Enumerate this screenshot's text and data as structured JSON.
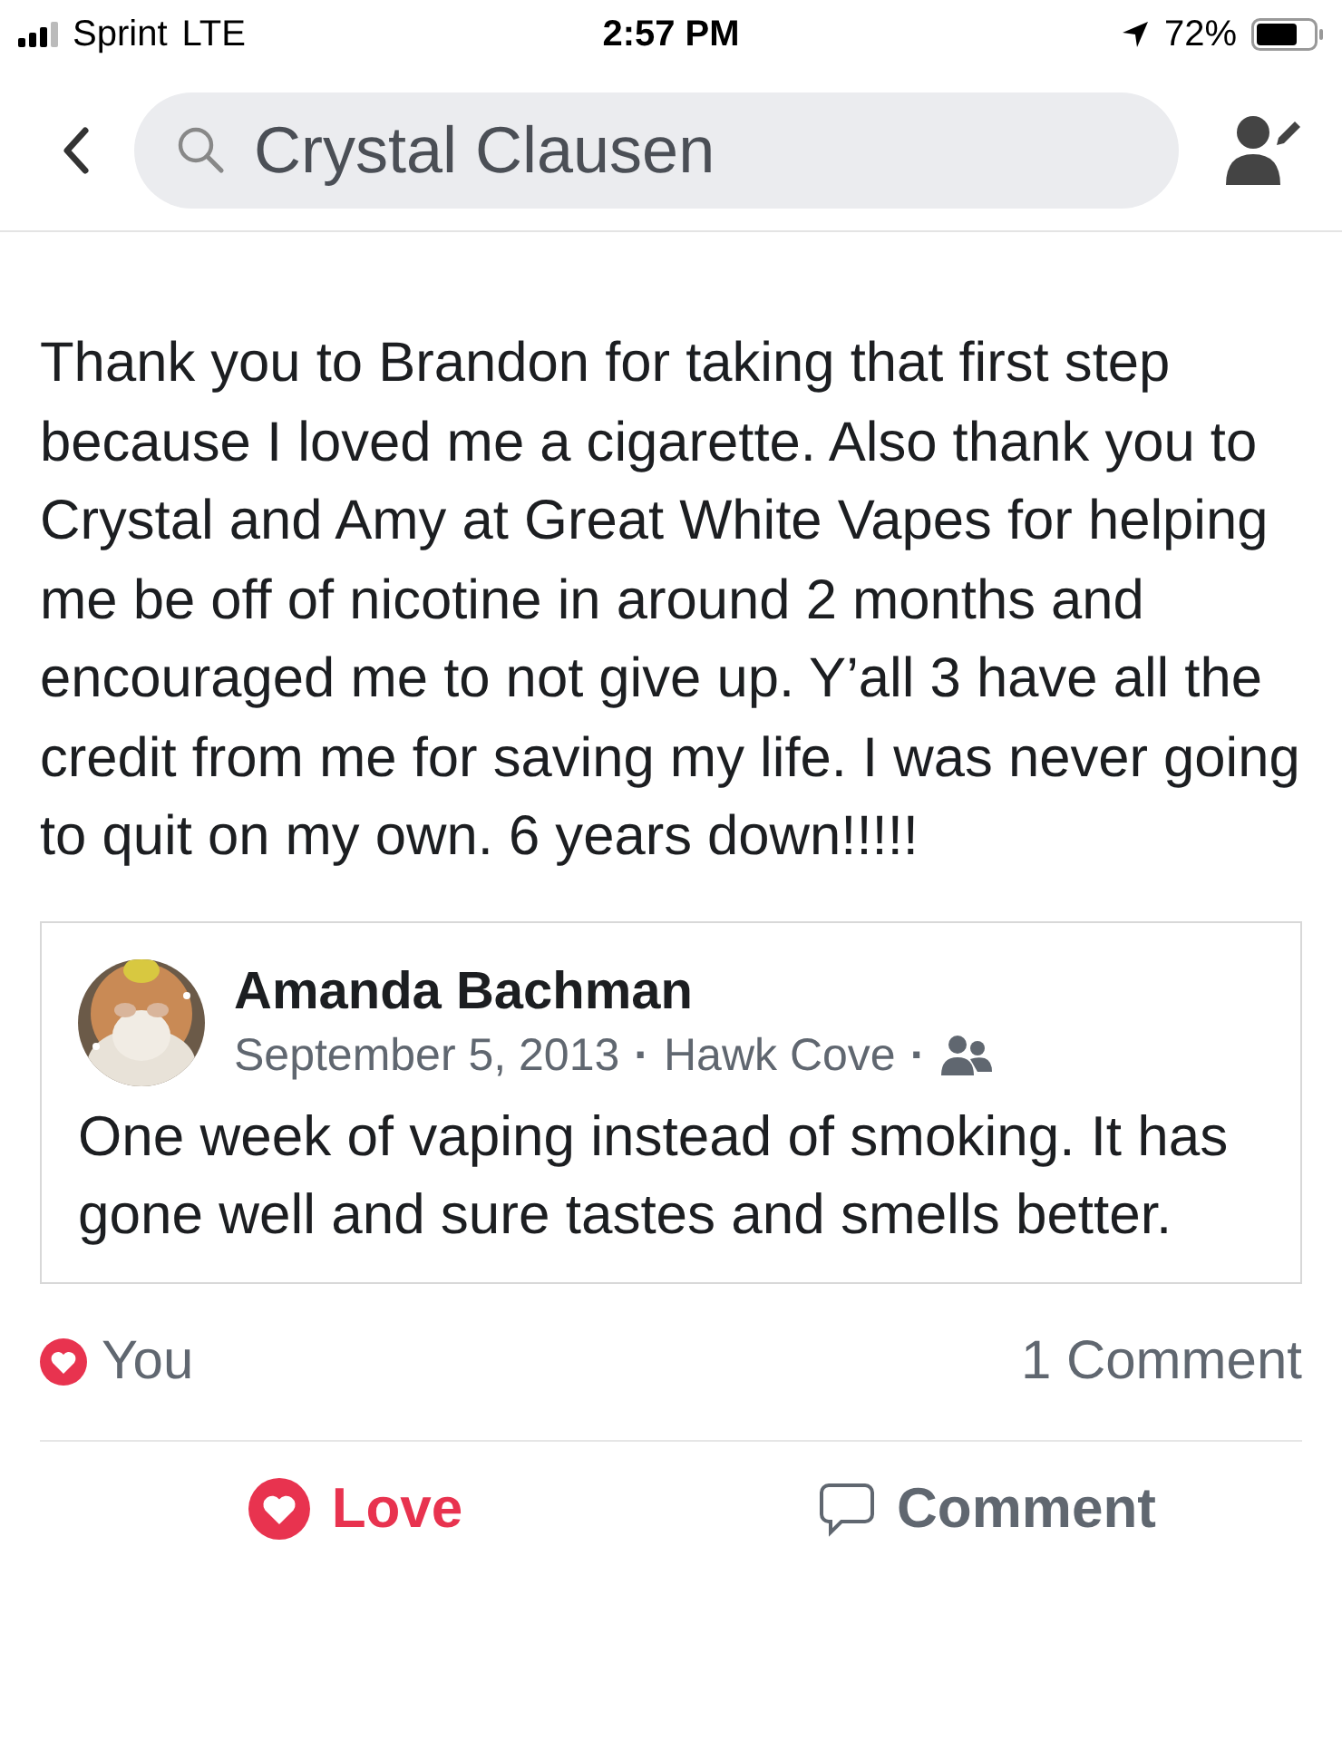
{
  "status_bar": {
    "carrier": "Sprint",
    "network": "LTE",
    "time": "2:57 PM",
    "battery": "72%"
  },
  "header": {
    "search": {
      "value": "Crystal Clausen"
    }
  },
  "post": {
    "text": "Thank you to Brandon for taking that first step because I loved me a cigarette. Also thank you to Crystal and Amy at Great White Vapes for helping me be off of nicotine in around 2 months and encouraged me to not give up. Y’all 3 have all the credit from me for saving my life. I was never going to quit on my own. 6 years down!!!!!",
    "shared": {
      "author": "Amanda Bachman",
      "date": "September 5, 2013",
      "separator_1": "·",
      "place": "Hawk Cove",
      "separator_2": "·",
      "text": "One week of vaping instead of smoking. It has gone well and sure tastes and smells better."
    },
    "reactions": {
      "label": "You",
      "comments": "1 Comment"
    },
    "actions": [
      {
        "label": "Love",
        "kind": "love",
        "selected": true
      },
      {
        "label": "Comment",
        "kind": "comment",
        "selected": false
      }
    ]
  }
}
